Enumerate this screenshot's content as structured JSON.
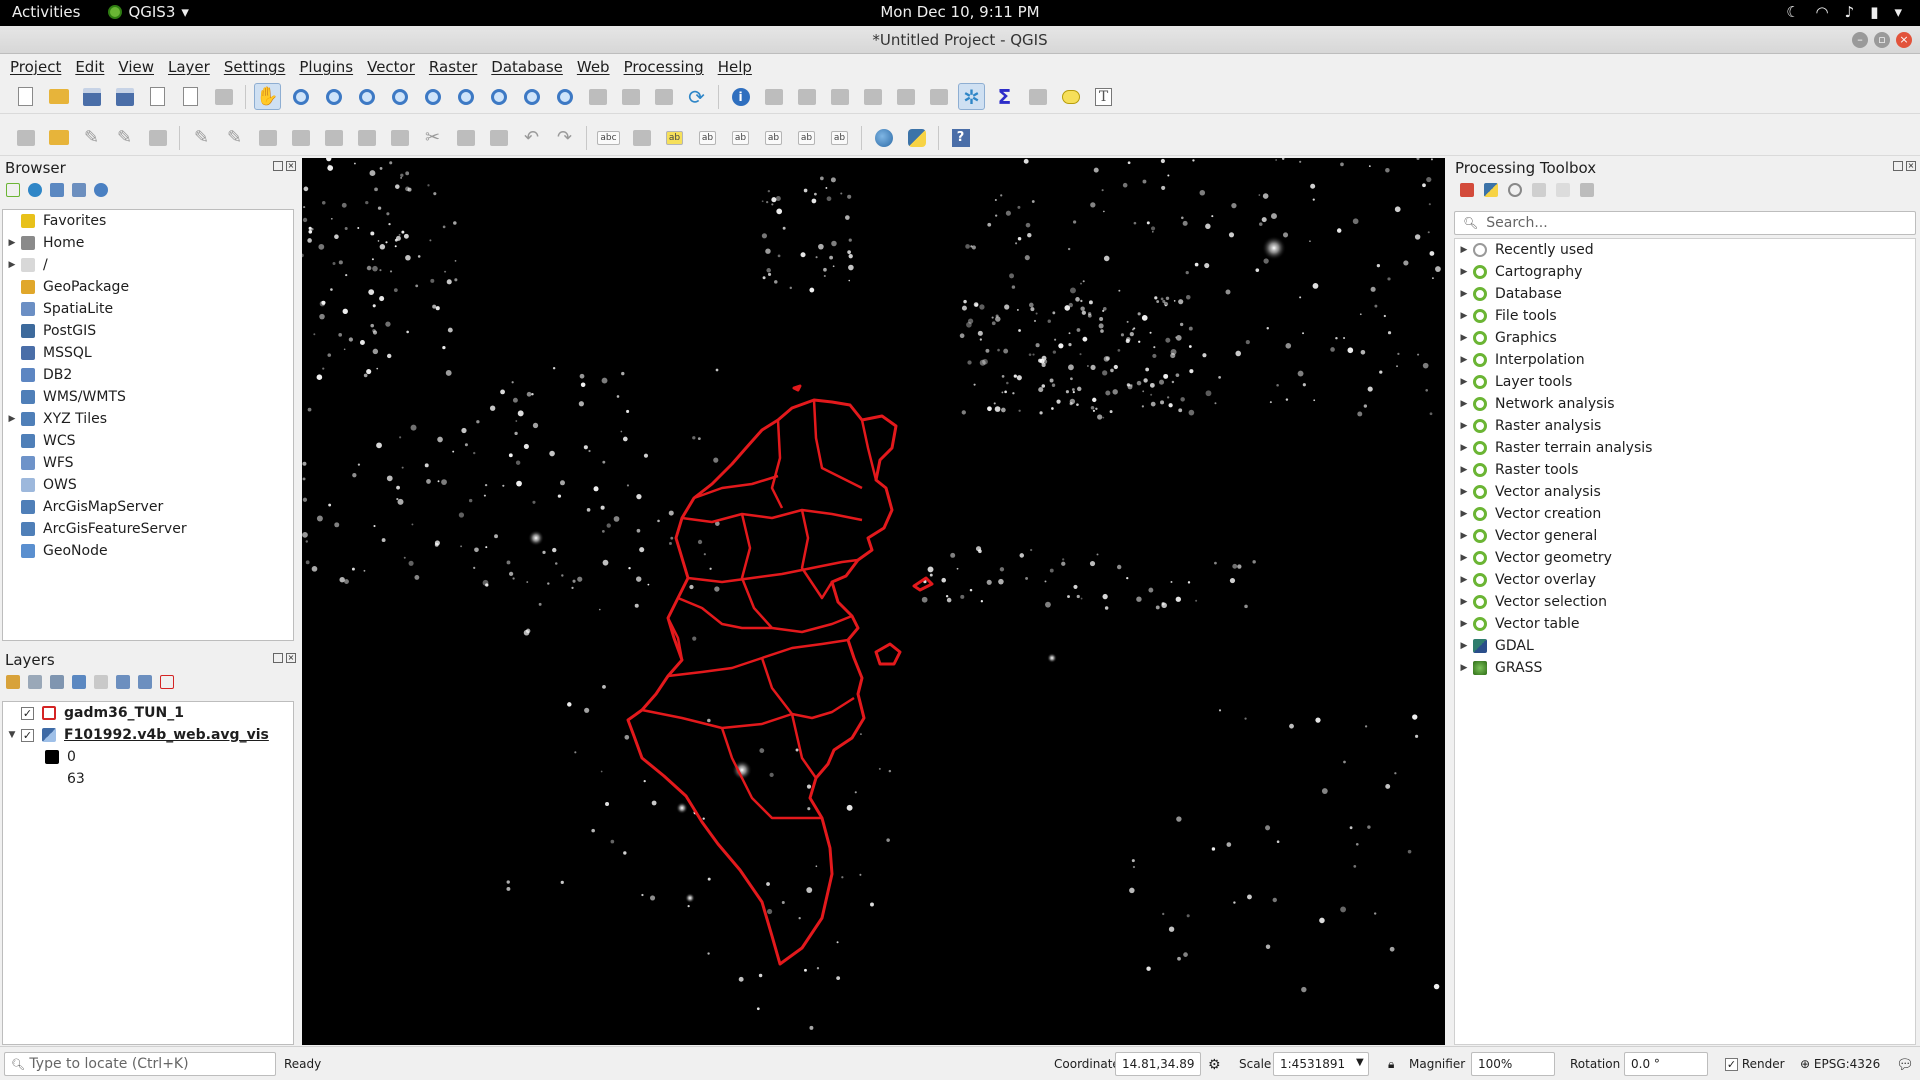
{
  "system_bar": {
    "activities": "Activities",
    "app_menu": "QGIS3",
    "clock": "Mon Dec 10,  9:11 PM"
  },
  "window": {
    "title": "*Untitled Project - QGIS"
  },
  "menubar": [
    "Project",
    "Edit",
    "View",
    "Layer",
    "Settings",
    "Plugins",
    "Vector",
    "Raster",
    "Database",
    "Web",
    "Processing",
    "Help"
  ],
  "browser": {
    "title": "Browser",
    "items": [
      {
        "label": "Favorites",
        "icon": "star-icon",
        "expandable": false,
        "color": "#e8c11a"
      },
      {
        "label": "Home",
        "icon": "home-icon",
        "expandable": true,
        "color": "#8a8a8a"
      },
      {
        "label": "/",
        "icon": "folder-icon",
        "expandable": true,
        "color": "#d8d8d8"
      },
      {
        "label": "GeoPackage",
        "icon": "geopackage-icon",
        "expandable": false,
        "color": "#e0a72b"
      },
      {
        "label": "SpatiaLite",
        "icon": "feather-icon",
        "expandable": false,
        "color": "#6b8fc4"
      },
      {
        "label": "PostGIS",
        "icon": "elephant-icon",
        "expandable": false,
        "color": "#3d6a9c"
      },
      {
        "label": "MSSQL",
        "icon": "mssql-icon",
        "expandable": false,
        "color": "#4a6ea8"
      },
      {
        "label": "DB2",
        "icon": "db2-icon",
        "expandable": false,
        "color": "#5d86c2"
      },
      {
        "label": "WMS/WMTS",
        "icon": "globe-icon",
        "expandable": false,
        "color": "#4f7fb8"
      },
      {
        "label": "XYZ Tiles",
        "icon": "globe-icon",
        "expandable": true,
        "color": "#4f7fb8"
      },
      {
        "label": "WCS",
        "icon": "globe-icon",
        "expandable": false,
        "color": "#4f7fb8"
      },
      {
        "label": "WFS",
        "icon": "wfs-icon",
        "expandable": false,
        "color": "#6e93c9"
      },
      {
        "label": "OWS",
        "icon": "ows-icon",
        "expandable": false,
        "color": "#9db8dc"
      },
      {
        "label": "ArcGisMapServer",
        "icon": "arcgis-icon",
        "expandable": false,
        "color": "#4f7fb8"
      },
      {
        "label": "ArcGisFeatureServer",
        "icon": "arcgis-icon",
        "expandable": false,
        "color": "#4f7fb8"
      },
      {
        "label": "GeoNode",
        "icon": "geonode-icon",
        "expandable": false,
        "color": "#5a8fcf"
      }
    ]
  },
  "layers": {
    "title": "Layers",
    "items": [
      {
        "label": "gadm36_TUN_1",
        "checked": true,
        "symbol": "red-outline-polygon",
        "color": "#d42424"
      },
      {
        "label": "F101992.v4b_web.avg_vis",
        "checked": true,
        "symbol": "raster-icon",
        "expanded": true,
        "legend": [
          {
            "label": "0",
            "color": "#000000"
          },
          {
            "label": "63",
            "color": "#ffffff"
          }
        ]
      }
    ]
  },
  "processing": {
    "title": "Processing Toolbox",
    "search_placeholder": "Search...",
    "items": [
      {
        "label": "Recently used",
        "icon": "clock-icon"
      },
      {
        "label": "Cartography",
        "icon": "qgis-icon"
      },
      {
        "label": "Database",
        "icon": "qgis-icon"
      },
      {
        "label": "File tools",
        "icon": "qgis-icon"
      },
      {
        "label": "Graphics",
        "icon": "qgis-icon"
      },
      {
        "label": "Interpolation",
        "icon": "qgis-icon"
      },
      {
        "label": "Layer tools",
        "icon": "qgis-icon"
      },
      {
        "label": "Network analysis",
        "icon": "qgis-icon"
      },
      {
        "label": "Raster analysis",
        "icon": "qgis-icon"
      },
      {
        "label": "Raster terrain analysis",
        "icon": "qgis-icon"
      },
      {
        "label": "Raster tools",
        "icon": "qgis-icon"
      },
      {
        "label": "Vector analysis",
        "icon": "qgis-icon"
      },
      {
        "label": "Vector creation",
        "icon": "qgis-icon"
      },
      {
        "label": "Vector general",
        "icon": "qgis-icon"
      },
      {
        "label": "Vector geometry",
        "icon": "qgis-icon"
      },
      {
        "label": "Vector overlay",
        "icon": "qgis-icon"
      },
      {
        "label": "Vector selection",
        "icon": "qgis-icon"
      },
      {
        "label": "Vector table",
        "icon": "qgis-icon"
      },
      {
        "label": "GDAL",
        "icon": "gdal-icon"
      },
      {
        "label": "GRASS",
        "icon": "grass-icon"
      }
    ]
  },
  "statusbar": {
    "locate_placeholder": "Type to locate (Ctrl+K)",
    "status": "Ready",
    "coordinate_label": "Coordinate",
    "coordinate": "14.81,34.89",
    "scale_label": "Scale",
    "scale": "1:4531891",
    "magnifier_label": "Magnifier",
    "magnifier": "100%",
    "rotation_label": "Rotation",
    "rotation": "0.0 °",
    "render_label": "Render",
    "render_checked": true,
    "crs": "EPSG:4326"
  },
  "map": {
    "boundary_color": "#e3191c",
    "background": "#000000"
  }
}
